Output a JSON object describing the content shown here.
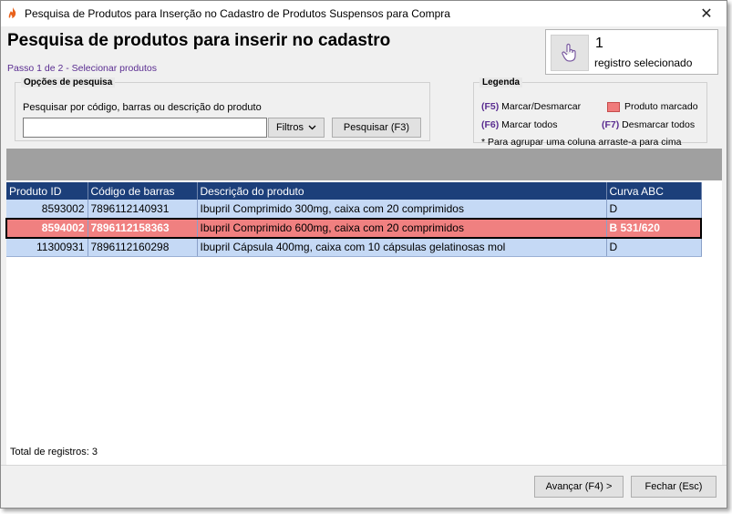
{
  "window": {
    "title": "Pesquisa de Produtos para Inserção no Cadastro de Produtos Suspensos para Compra",
    "close_glyph": "✕",
    "app_icon": "flame-logo-icon"
  },
  "header": {
    "title": "Pesquisa de produtos para inserir no cadastro",
    "step": "Passo 1 de 2 - Selecionar produtos"
  },
  "selection": {
    "count": "1",
    "label": "registro selecionado",
    "icon": "hand-pointer-icon"
  },
  "search_options": {
    "legend": "Opções de pesquisa",
    "label": "Pesquisar por código, barras ou descrição do produto",
    "value": "",
    "filters_label": "Filtros",
    "search_button": "Pesquisar (F3)"
  },
  "legend": {
    "title": "Legenda",
    "f5_key": "(F5)",
    "f5_text": "Marcar/Desmarcar",
    "marked_text": "Produto marcado",
    "marked_color": "#f07b7b",
    "f6_key": "(F6)",
    "f6_text": "Marcar todos",
    "f7_key": "(F7)",
    "f7_text": "Desmarcar todos",
    "note": "* Para agrupar uma coluna arraste-a para cima"
  },
  "table": {
    "columns": [
      "Produto ID",
      "Código de barras",
      "Descrição do produto",
      "Curva ABC"
    ],
    "rows": [
      {
        "id": "8593002",
        "barcode": "7896112140931",
        "description": "Ibupril Comprimido 300mg, caixa com 20 comprimidos",
        "curve": "D",
        "marked": false
      },
      {
        "id": "8594002",
        "barcode": "7896112158363",
        "description": "Ibupril Comprimido 600mg, caixa com 20 comprimidos",
        "curve": "B 531/620",
        "marked": true
      },
      {
        "id": "11300931",
        "barcode": "7896112160298",
        "description": "Ibupril Cápsula 400mg, caixa com 10 cápsulas gelatinosas mol",
        "curve": "D",
        "marked": false
      }
    ]
  },
  "footer": {
    "total": "Total de registros: 3",
    "next_button": "Avançar (F4) >",
    "close_button": "Fechar (Esc)"
  },
  "colors": {
    "header_bg": "#1c3f7a",
    "row_bg": "#c5d9f5",
    "marked_row_bg": "#f08080",
    "accent_text": "#5a2d91"
  }
}
